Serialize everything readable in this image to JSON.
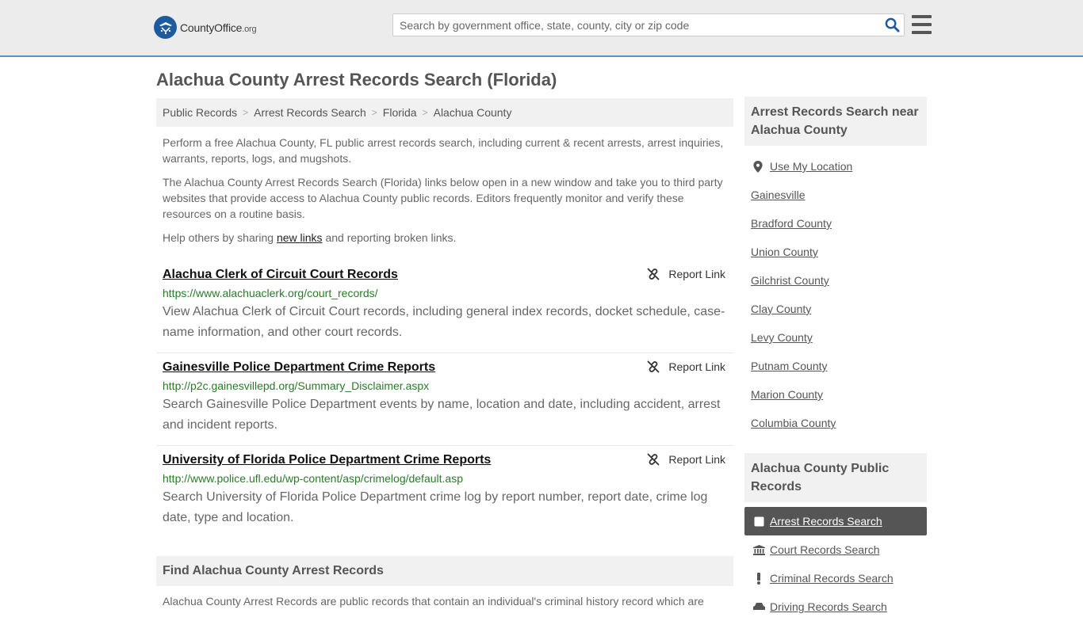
{
  "header": {
    "logo_main": "CountyOffice",
    "logo_suffix": ".org",
    "search_placeholder": "Search by government office, state, county, city or zip code"
  },
  "page_title": "Alachua County Arrest Records Search (Florida)",
  "breadcrumb": [
    "Public Records",
    "Arrest Records Search",
    "Florida",
    "Alachua County"
  ],
  "intro": {
    "p1": "Perform a free Alachua County, FL public arrest records search, including current & recent arrests, arrest inquiries, warrants, reports, logs, and mugshots.",
    "p2": "The Alachua County Arrest Records Search (Florida) links below open in a new window and take you to third party websites that provide access to Alachua County public records. Editors frequently monitor and verify these resources on a routine basis.",
    "p3_before": "Help others by sharing ",
    "p3_link": "new links",
    "p3_after": " and reporting broken links."
  },
  "report_label": "Report Link",
  "links": [
    {
      "title": "Alachua Clerk of Circuit Court Records",
      "url": "https://www.alachuaclerk.org/court_records/",
      "desc": "View Alachua Clerk of Circuit Court records, including general index records, docket schedule, case-name information, and other court records."
    },
    {
      "title": "Gainesville Police Department Crime Reports",
      "url": "http://p2c.gainesvillepd.org/Summary_Disclaimer.aspx",
      "desc": "Search Gainesville Police Department events by name, location and date, including accident, arrest and incident reports."
    },
    {
      "title": "University of Florida Police Department Crime Reports",
      "url": "http://www.police.ufl.edu/wp-content/asp/crimelog/default.asp",
      "desc": "Search University of Florida Police Department crime log by report number, report date, crime log date, type and location."
    }
  ],
  "find_section": {
    "title": "Find Alachua County Arrest Records",
    "text": "Alachua County Arrest Records are public records that contain an individual's criminal history record which are"
  },
  "sidebar": {
    "near_title": "Arrest Records Search near Alachua County",
    "use_location": "Use My Location",
    "near_items": [
      "Gainesville",
      "Bradford County",
      "Union County",
      "Gilchrist County",
      "Clay County",
      "Levy County",
      "Putnam County",
      "Marion County",
      "Columbia County"
    ],
    "public_title": "Alachua County Public Records",
    "public_items": [
      "Arrest Records Search",
      "Court Records Search",
      "Criminal Records Search",
      "Driving Records Search"
    ]
  },
  "colors": {
    "accent_border": "#5b8fc7",
    "logo_blue": "#1e5a9e",
    "url_green": "#2a7a2a",
    "active_bg": "#555555"
  }
}
